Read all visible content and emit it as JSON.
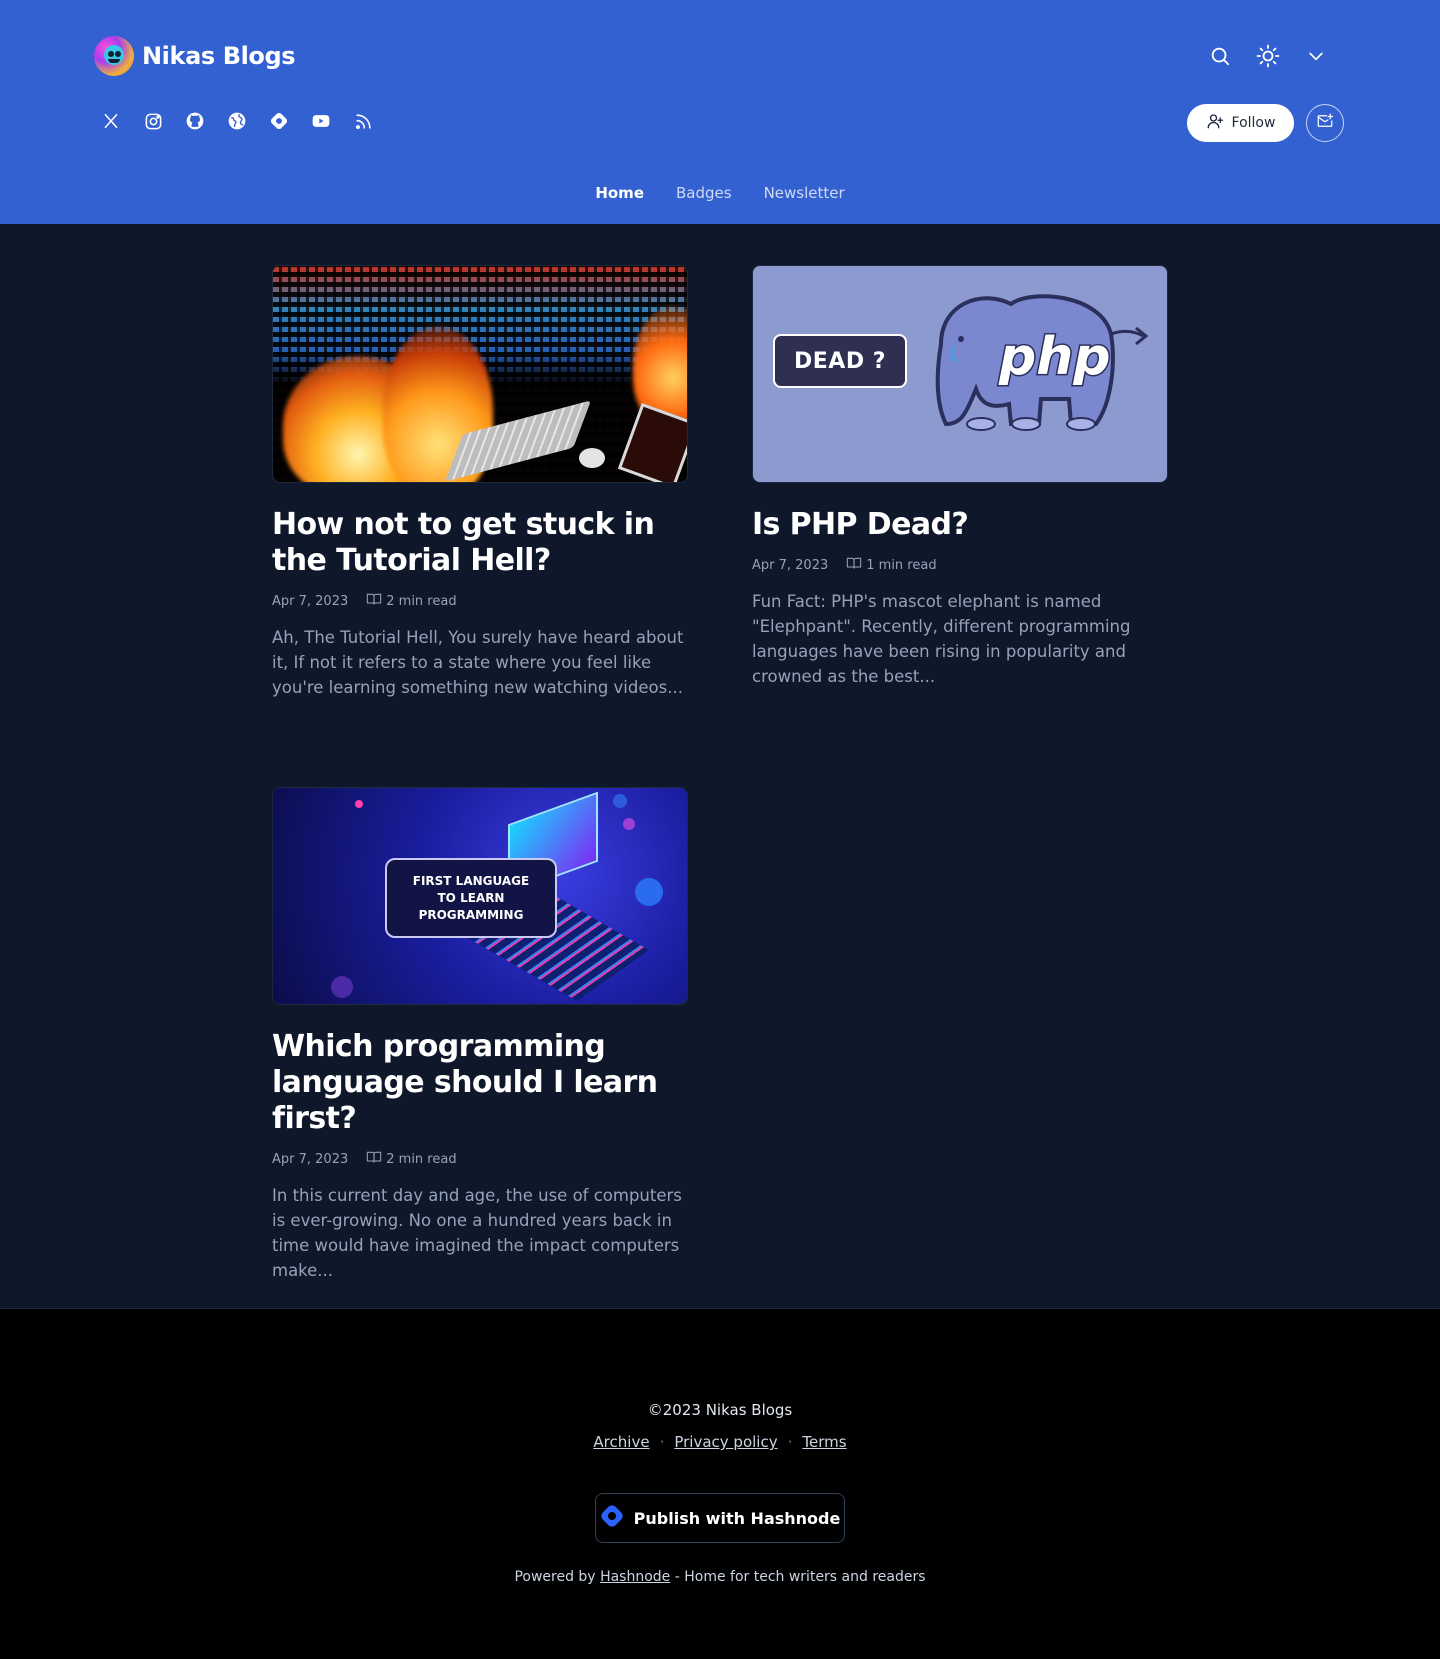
{
  "brand": {
    "title": "Nikas Blogs"
  },
  "header": {
    "top_icons": [
      "search-icon",
      "sun-icon",
      "chevron-down-icon"
    ],
    "social_icons": [
      "x-icon",
      "instagram-icon",
      "github-icon",
      "globe-icon",
      "hashnode-icon",
      "youtube-icon",
      "rss-icon"
    ],
    "follow_label": "Follow"
  },
  "nav": {
    "items": [
      {
        "label": "Home",
        "active": true
      },
      {
        "label": "Badges",
        "active": false
      },
      {
        "label": "Newsletter",
        "active": false
      }
    ]
  },
  "posts": [
    {
      "title": "How not to get stuck in the Tutorial Hell?",
      "date": "Apr 7, 2023",
      "read_time": "2 min read",
      "excerpt": "Ah, The Tutorial Hell, You surely have heard about it, If not it refers to a state where you feel like you're learning something new watching videos..."
    },
    {
      "title": "Is PHP Dead?",
      "date": "Apr 7, 2023",
      "read_time": "1 min read",
      "excerpt": "Fun Fact: PHP's mascot elephant is named \"Elephpant\". Recently, different programming languages have been rising in popularity and crowned as the best...",
      "cover_text": "DEAD ?",
      "cover_logo_text": "php"
    },
    {
      "title": "Which programming language should I learn first?",
      "date": "Apr 7, 2023",
      "read_time": "2 min read",
      "excerpt": "In this current day and age, the use of computers is ever-growing. No one a hundred years back in time would have imagined the impact computers make...",
      "cover_text_1": "FIRST LANGUAGE",
      "cover_text_2": "TO LEARN",
      "cover_text_3": "PROGRAMMING"
    }
  ],
  "footer": {
    "copyright": "©2023 Nikas Blogs",
    "links": [
      "Archive",
      "Privacy policy",
      "Terms"
    ],
    "separator": "·",
    "publish_label": "Publish with Hashnode",
    "powered_prefix": "Powered by",
    "powered_link": "Hashnode",
    "powered_suffix": "- Home for tech writers and readers"
  },
  "colors": {
    "header_bg": "#3461d1",
    "body_bg": "#0f172a",
    "footer_bg": "#000000",
    "accent": "#2962ff"
  }
}
